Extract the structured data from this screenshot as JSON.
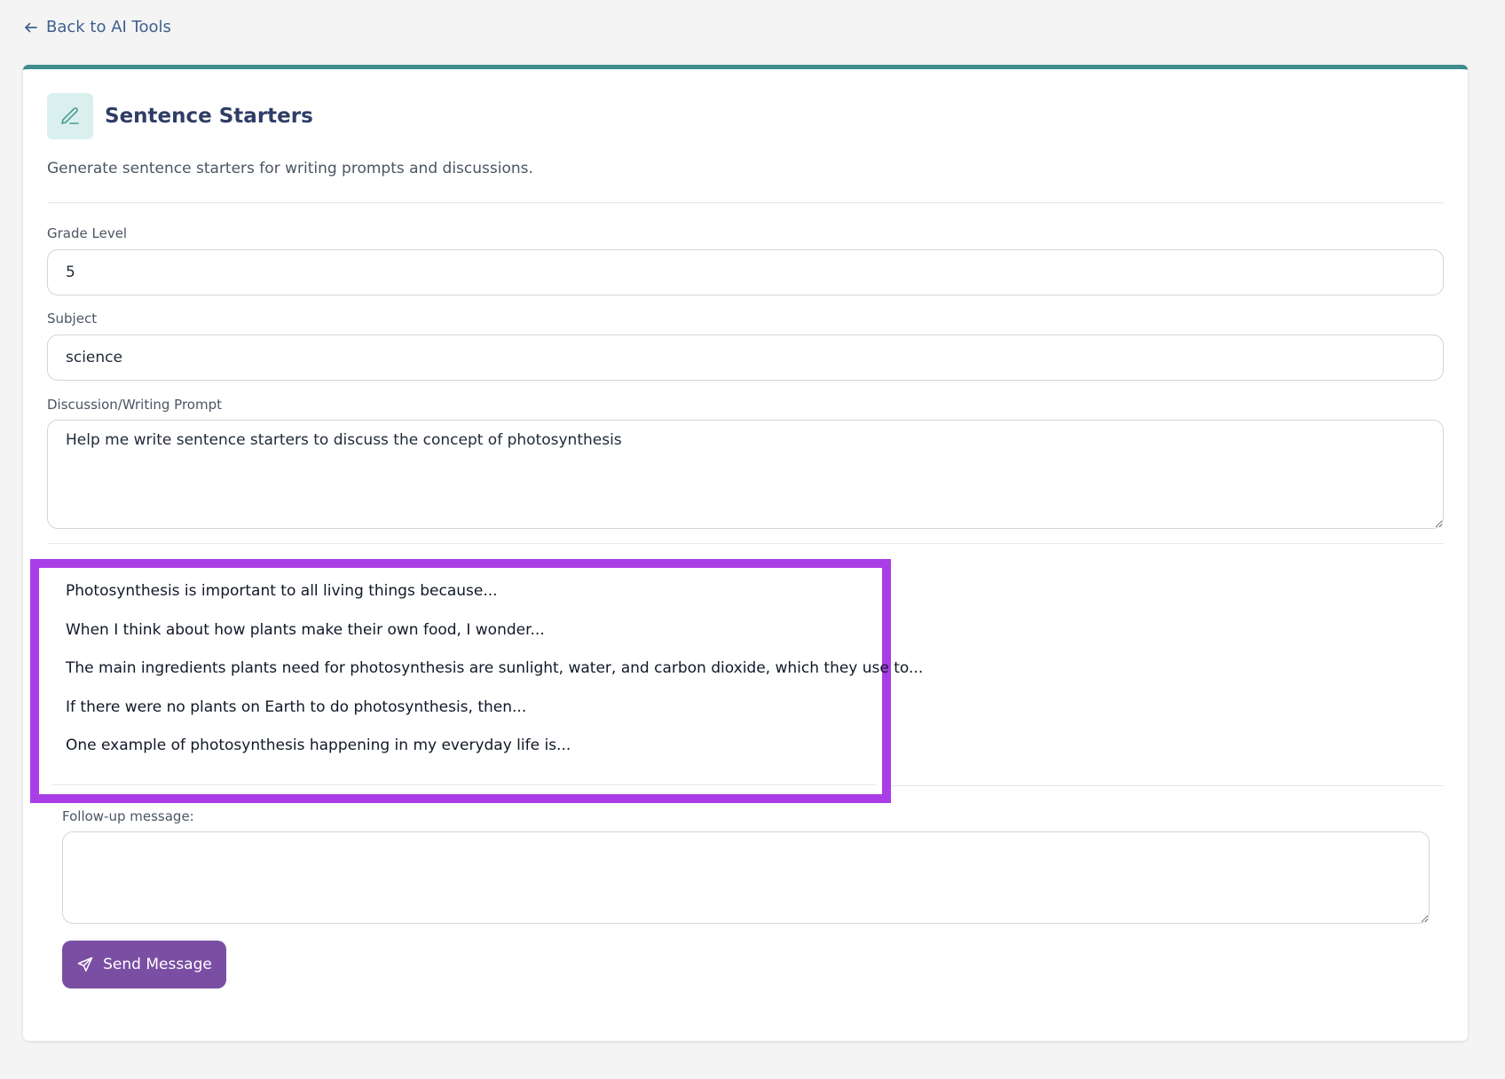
{
  "nav": {
    "back_label": "Back to AI Tools"
  },
  "tool": {
    "title": "Sentence Starters",
    "description": "Generate sentence starters for writing prompts and discussions.",
    "icon": "pencil-icon",
    "accent_color": "#3e8c8c",
    "icon_bg_color": "#d9f0ee"
  },
  "form": {
    "grade_level": {
      "label": "Grade Level",
      "value": "5"
    },
    "subject": {
      "label": "Subject",
      "value": "science"
    },
    "prompt": {
      "label": "Discussion/Writing Prompt",
      "value": "Help me write sentence starters to discuss the concept of photosynthesis"
    }
  },
  "response": {
    "highlight_color": "#a93ee6",
    "items": [
      "Photosynthesis is important to all living things because...",
      "When I think about how plants make their own food, I wonder...",
      "The main ingredients plants need for photosynthesis are sunlight, water, and carbon dioxide, which they use to...",
      "If there were no plants on Earth to do photosynthesis, then...",
      "One example of photosynthesis happening in my everyday life is..."
    ]
  },
  "followup": {
    "label": "Follow-up message:",
    "value": "",
    "send_label": "Send Message",
    "send_icon": "send-icon",
    "button_color": "#7a4fa3"
  }
}
